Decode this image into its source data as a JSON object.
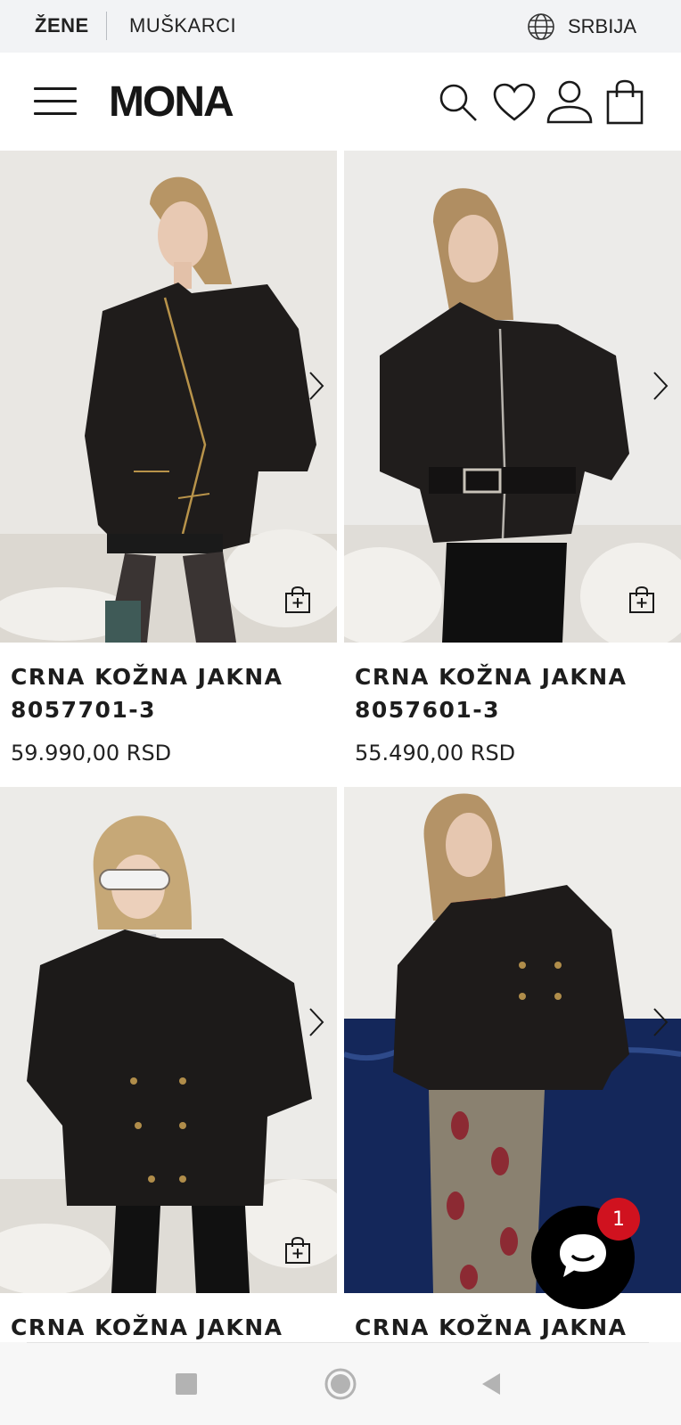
{
  "topbar": {
    "tabs": [
      {
        "label": "ŽENE",
        "active": true
      },
      {
        "label": "MUŠKARCI",
        "active": false
      }
    ],
    "region_label": "SRBIJA",
    "region_icon": "globe-icon"
  },
  "header": {
    "logo": "MONA",
    "icons": [
      "menu-icon",
      "search-icon",
      "heart-icon",
      "user-icon",
      "shopping-bag-icon"
    ]
  },
  "products": [
    {
      "title_line1": "CRNA KOŽNA JAKNA",
      "title_line2": "8057701-3",
      "price": "59.990,00 RSD"
    },
    {
      "title_line1": "CRNA KOŽNA JAKNA",
      "title_line2": "8057601-3",
      "price": "55.490,00 RSD"
    },
    {
      "title_line1": "CRNA KOŽNA JAKNA",
      "title_line2": "",
      "price": ""
    },
    {
      "title_line1": "CRNA KOŽNA JAKNA",
      "title_line2": "",
      "price": ""
    }
  ],
  "chat": {
    "badge_count": "1",
    "icon": "chat-bubble-icon"
  },
  "colors": {
    "topbar_bg": "#f2f3f5",
    "text": "#1a1a1a",
    "badge": "#d0121f",
    "chat_bg": "#000000"
  },
  "system_nav": {
    "icons": [
      "recent-apps-icon",
      "home-icon",
      "back-icon"
    ]
  }
}
